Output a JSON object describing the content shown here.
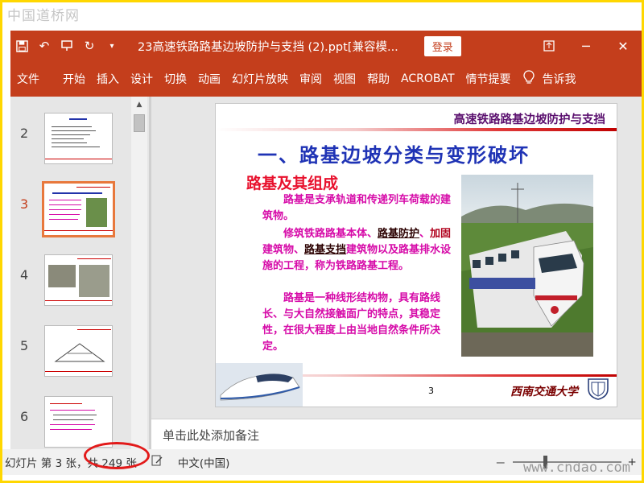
{
  "watermarks": {
    "top": "中国道桥网",
    "bottom": "www.cndao.com"
  },
  "titlebar": {
    "quick_access": [
      "save-icon",
      "undo-icon",
      "present-icon",
      "redo-icon",
      "customize-icon"
    ],
    "document_title": "23高速铁路路基边坡防护与支挡 (2).ppt[兼容模...",
    "login_label": "登录",
    "window_controls": [
      "ribbon-display-icon",
      "minimize-icon",
      "close-icon"
    ]
  },
  "ribbon": {
    "tabs": [
      "文件",
      "开始",
      "插入",
      "设计",
      "切换",
      "动画",
      "幻灯片放映",
      "审阅",
      "视图",
      "帮助",
      "ACROBAT",
      "情节提要"
    ],
    "tell_me": "告诉我"
  },
  "thumbnails": [
    {
      "number": "2",
      "active": false
    },
    {
      "number": "3",
      "active": true
    },
    {
      "number": "4",
      "active": false
    },
    {
      "number": "5",
      "active": false
    },
    {
      "number": "6",
      "active": false
    }
  ],
  "slide": {
    "header": "高速铁路路基边坡防护与支挡",
    "title": "一、路基边坡分类与变形破坏",
    "subtitle": "路基及其组成",
    "para1": "路基是支承轨道和传递列车荷载的建筑物。",
    "para2_a": "修筑铁路路基本体、",
    "para2_b": "路基防护",
    "para2_c": "、",
    "para2_d": "加固",
    "para2_e": "建筑物、",
    "para2_f": "路基支挡",
    "para2_g": "建筑物以及路基排水设施的工程，称为铁路路基工程。",
    "para3": "路基是一种线形结构物，具有路线长、与大自然接触面广的特点，其稳定性，在很大程度上由当地自然条件所决定。",
    "number": "3",
    "university": "西南交通大学"
  },
  "notes": {
    "placeholder": "单击此处添加备注"
  },
  "statusbar": {
    "slide_info_prefix": "幻灯片 第 3 张，",
    "slide_total": "共 249 张",
    "language": "中文(中国)",
    "zoom_minus": "－",
    "zoom_plus": "+",
    "zoom_level": "42"
  },
  "colors": {
    "accent": "#c43e1c",
    "highlight_circle": "#e21a1a",
    "slide_title": "#1f33b5",
    "slide_text": "#d60aa8"
  }
}
